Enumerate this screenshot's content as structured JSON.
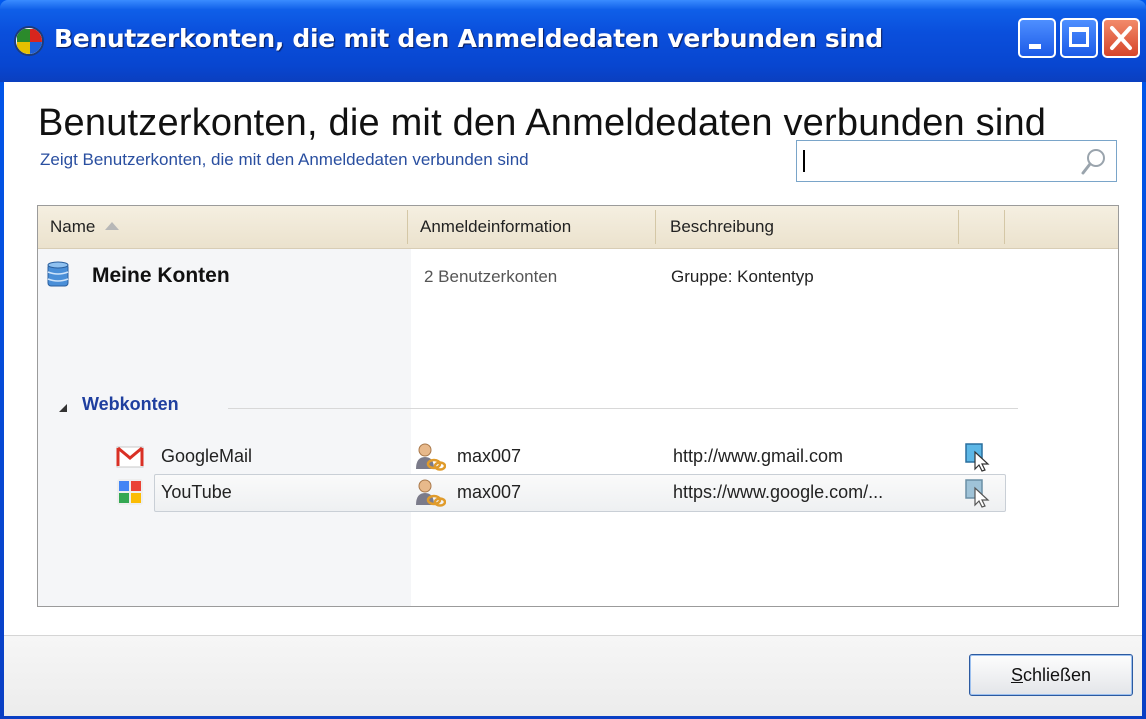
{
  "window": {
    "title": "Benutzerkonten, die mit den Anmeldedaten verbunden sind",
    "controls": [
      "minimize",
      "maximize",
      "close"
    ]
  },
  "page": {
    "heading": "Benutzerkonten, die mit den Anmeldedaten verbunden sind",
    "subheading": "Zeigt Benutzerkonten, die mit den Anmeldedaten verbunden sind",
    "search": {
      "value": "",
      "placeholder": ""
    }
  },
  "list": {
    "columns": [
      {
        "label": "Name",
        "sorted": "ascending"
      },
      {
        "label": "Anmeldeinformation"
      },
      {
        "label": "Beschreibung"
      },
      {
        "label": ""
      }
    ],
    "root": {
      "icon": "database-icon",
      "name": "Meine Konten",
      "info": "2 Benutzerkonten",
      "description": "Gruppe: Kontentyp"
    },
    "group": {
      "label": "Webkonten",
      "expanded": true
    },
    "rows": [
      {
        "icon": "gmail-icon",
        "name": "GoogleMail",
        "user_icon": "user-link-icon",
        "credential": "max007",
        "description": "http://www.gmail.com",
        "action_icon": "open-link-icon",
        "selected": false
      },
      {
        "icon": "google-icon",
        "name": "YouTube",
        "user_icon": "user-link-icon",
        "credential": "max007",
        "description": "https://www.google.com/...",
        "action_icon": "open-link-icon",
        "selected": true
      }
    ]
  },
  "footer": {
    "close_label_prefix": "",
    "close_label_accel": "S",
    "close_label_rest": "chließen"
  },
  "colors": {
    "title_bar": "#0a4fdc",
    "link_text": "#2a4fa0",
    "group_text": "#1f3f9f",
    "header_bg": "#ebe2cd"
  }
}
